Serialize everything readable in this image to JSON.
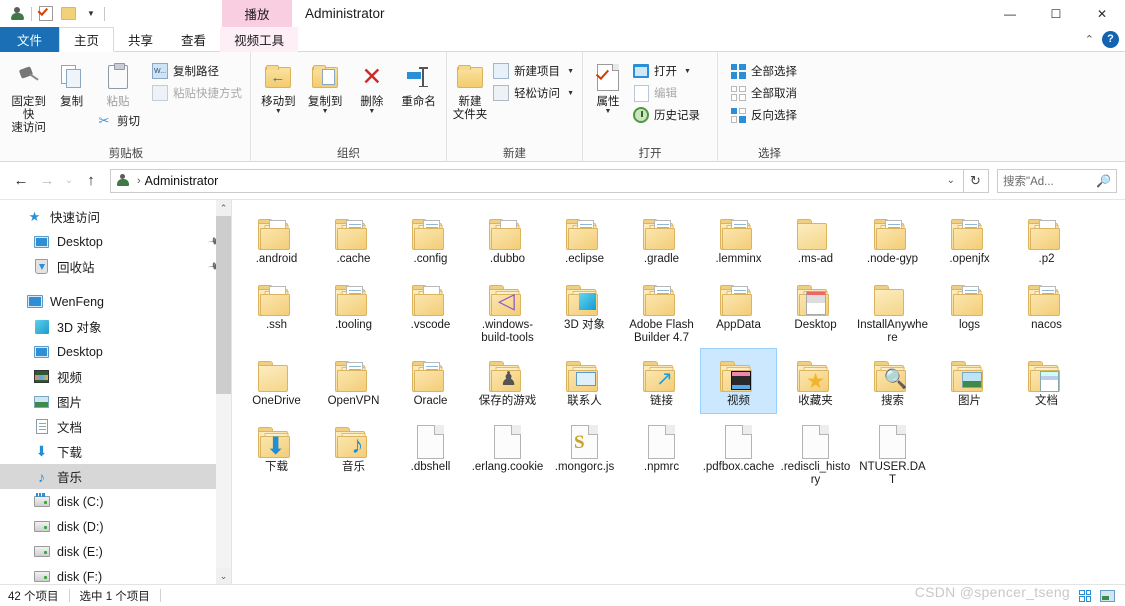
{
  "titlebar": {
    "quick_access": [
      {
        "name": "user-icon",
        "label": ""
      },
      {
        "name": "properties-icon",
        "label": ""
      },
      {
        "name": "new-folder-icon",
        "label": ""
      },
      {
        "name": "customize-dropdown-icon",
        "label": "▾"
      }
    ],
    "context_tab": "播放",
    "title": "Administrator",
    "minimize": "—",
    "maximize": "☐",
    "close": "✕"
  },
  "tabs": {
    "file": "文件",
    "items": [
      {
        "label": "主页",
        "active": true
      },
      {
        "label": "共享",
        "active": false
      },
      {
        "label": "查看",
        "active": false
      }
    ],
    "context_tab": "视频工具",
    "collapse": "⌃",
    "help": "?"
  },
  "ribbon": {
    "groups": [
      {
        "label": "剪贴板",
        "big": [
          {
            "label": "固定到快\n速访问",
            "label1": "固定到快",
            "label2": "速访问",
            "icon": "pin-icon",
            "dim": false
          },
          {
            "label": "复制",
            "label1": "复制",
            "label2": "",
            "icon": "copy-icon",
            "dim": false
          },
          {
            "label": "粘贴",
            "label1": "粘贴",
            "label2": "",
            "icon": "paste-icon",
            "dim": true
          }
        ],
        "small_under_paste": [
          {
            "label": "剪切",
            "icon": "scissors-icon",
            "dim": false
          }
        ],
        "small": [
          {
            "label": "复制路径",
            "icon": "copy-path-icon",
            "dim": false
          },
          {
            "label": "粘贴快捷方式",
            "icon": "paste-shortcut-icon",
            "dim": true
          }
        ]
      },
      {
        "label": "组织",
        "big": [
          {
            "label1": "移动到",
            "label2": "",
            "icon": "move-to-icon",
            "caret": true
          },
          {
            "label1": "复制到",
            "label2": "",
            "icon": "copy-to-icon",
            "caret": true
          },
          {
            "label1": "删除",
            "label2": "",
            "icon": "delete-icon",
            "caret": true
          },
          {
            "label1": "重命名",
            "label2": "",
            "icon": "rename-icon",
            "caret": false
          }
        ]
      },
      {
        "label": "新建",
        "big": [
          {
            "label1": "新建",
            "label2": "文件夹",
            "icon": "new-folder-icon",
            "caret": false
          }
        ],
        "small": [
          {
            "label": "新建项目",
            "icon": "new-item-icon",
            "caret": true
          },
          {
            "label": "轻松访问",
            "icon": "easy-access-icon",
            "caret": true
          }
        ]
      },
      {
        "label": "打开",
        "big": [
          {
            "label1": "属性",
            "label2": "",
            "icon": "properties-icon",
            "caret": true
          }
        ],
        "small": [
          {
            "label": "打开",
            "icon": "open-icon",
            "caret": true,
            "dim": false
          },
          {
            "label": "编辑",
            "icon": "edit-icon",
            "caret": false,
            "dim": true
          },
          {
            "label": "历史记录",
            "icon": "history-icon",
            "caret": false,
            "dim": false
          }
        ]
      },
      {
        "label": "选择",
        "small": [
          {
            "label": "全部选择",
            "icon": "select-all-icon"
          },
          {
            "label": "全部取消",
            "icon": "select-none-icon"
          },
          {
            "label": "反向选择",
            "icon": "invert-selection-icon"
          }
        ]
      }
    ]
  },
  "addressbar": {
    "back": "←",
    "forward": "→",
    "recent": "⌄",
    "up": "↑",
    "breadcrumb_icon": "user-icon",
    "breadcrumb_sep": "›",
    "path": "Administrator",
    "dropdown": "⌄",
    "refresh": "↻",
    "search_placeholder": "搜索\"Ad...",
    "search_value": ""
  },
  "navpane": {
    "items": [
      {
        "label": "快速访问",
        "icon": "star-icon",
        "level": 1,
        "pinned": false,
        "selected": false
      },
      {
        "label": "Desktop",
        "icon": "monitor-icon",
        "level": 2,
        "pinned": true,
        "selected": false
      },
      {
        "label": "回收站",
        "icon": "recycle-bin-icon",
        "level": 2,
        "pinned": true,
        "selected": false
      },
      {
        "label": "",
        "icon": "spacer",
        "level": 1,
        "pinned": false,
        "selected": false,
        "spacer": true
      },
      {
        "label": "WenFeng",
        "icon": "this-pc-icon",
        "level": 1,
        "pinned": false,
        "selected": false
      },
      {
        "label": "3D 对象",
        "icon": "3d-objects-icon",
        "level": 2,
        "pinned": false,
        "selected": false
      },
      {
        "label": "Desktop",
        "icon": "desktop-icon",
        "level": 2,
        "pinned": false,
        "selected": false
      },
      {
        "label": "视频",
        "icon": "videos-icon",
        "level": 2,
        "pinned": false,
        "selected": false
      },
      {
        "label": "图片",
        "icon": "pictures-icon",
        "level": 2,
        "pinned": false,
        "selected": false
      },
      {
        "label": "文档",
        "icon": "documents-icon",
        "level": 2,
        "pinned": false,
        "selected": false
      },
      {
        "label": "下载",
        "icon": "downloads-icon",
        "level": 2,
        "pinned": false,
        "selected": false
      },
      {
        "label": "音乐",
        "icon": "music-icon",
        "level": 2,
        "pinned": false,
        "selected": true
      },
      {
        "label": "disk (C:)",
        "icon": "system-drive-icon",
        "level": 2,
        "pinned": false,
        "selected": false
      },
      {
        "label": "disk (D:)",
        "icon": "drive-icon",
        "level": 2,
        "pinned": false,
        "selected": false
      },
      {
        "label": "disk (E:)",
        "icon": "drive-icon",
        "level": 2,
        "pinned": false,
        "selected": false
      },
      {
        "label": "disk (F:)",
        "icon": "drive-icon",
        "level": 2,
        "pinned": false,
        "selected": false
      }
    ],
    "scroll_up": "⌃",
    "scroll_down": "⌄"
  },
  "files": [
    {
      "name": ".android",
      "type": "folder",
      "variant": "doc",
      "selected": false
    },
    {
      "name": ".cache",
      "type": "folder",
      "variant": "lines",
      "selected": false
    },
    {
      "name": ".config",
      "type": "folder",
      "variant": "lines",
      "selected": false
    },
    {
      "name": ".dubbo",
      "type": "folder",
      "variant": "doc",
      "selected": false
    },
    {
      "name": ".eclipse",
      "type": "folder",
      "variant": "lines",
      "selected": false
    },
    {
      "name": ".gradle",
      "type": "folder",
      "variant": "lines",
      "selected": false
    },
    {
      "name": ".lemminx",
      "type": "folder",
      "variant": "lines",
      "selected": false
    },
    {
      "name": ".ms-ad",
      "type": "folder",
      "variant": "empty",
      "selected": false
    },
    {
      "name": ".node-gyp",
      "type": "folder",
      "variant": "lines",
      "selected": false
    },
    {
      "name": ".openjfx",
      "type": "folder",
      "variant": "lines",
      "selected": false
    },
    {
      "name": ".p2",
      "type": "folder",
      "variant": "doc",
      "selected": false
    },
    {
      "name": ".ssh",
      "type": "folder",
      "variant": "doc",
      "selected": false
    },
    {
      "name": ".tooling",
      "type": "folder",
      "variant": "lines",
      "selected": false
    },
    {
      "name": ".vscode",
      "type": "folder",
      "variant": "doc",
      "selected": false
    },
    {
      "name": ".windows-build-tools",
      "type": "folder",
      "variant": "vscode",
      "selected": false
    },
    {
      "name": "3D 对象",
      "type": "folder",
      "variant": "cube",
      "selected": false
    },
    {
      "name": "Adobe Flash Builder 4.7",
      "type": "folder",
      "variant": "lines",
      "selected": false
    },
    {
      "name": "AppData",
      "type": "folder",
      "variant": "lines",
      "selected": false
    },
    {
      "name": "Desktop",
      "type": "folder",
      "variant": "desktop",
      "selected": false
    },
    {
      "name": "InstallAnywhere",
      "type": "folder",
      "variant": "empty",
      "selected": false
    },
    {
      "name": "logs",
      "type": "folder",
      "variant": "lines",
      "selected": false
    },
    {
      "name": "nacos",
      "type": "folder",
      "variant": "lines",
      "selected": false
    },
    {
      "name": "OneDrive",
      "type": "folder",
      "variant": "empty",
      "selected": false
    },
    {
      "name": "OpenVPN",
      "type": "folder",
      "variant": "lines",
      "selected": false
    },
    {
      "name": "Oracle",
      "type": "folder",
      "variant": "lines",
      "selected": false
    },
    {
      "name": "保存的游戏",
      "type": "folder",
      "variant": "games",
      "selected": false
    },
    {
      "name": "联系人",
      "type": "folder",
      "variant": "contacts",
      "selected": false
    },
    {
      "name": "链接",
      "type": "folder",
      "variant": "links",
      "selected": false
    },
    {
      "name": "视频",
      "type": "folder",
      "variant": "videos",
      "selected": true
    },
    {
      "name": "收藏夹",
      "type": "folder",
      "variant": "favorites",
      "selected": false
    },
    {
      "name": "搜索",
      "type": "folder",
      "variant": "search",
      "selected": false
    },
    {
      "name": "图片",
      "type": "folder",
      "variant": "pictures",
      "selected": false
    },
    {
      "name": "文档",
      "type": "folder",
      "variant": "documents",
      "selected": false
    },
    {
      "name": "下载",
      "type": "folder",
      "variant": "downloads",
      "selected": false
    },
    {
      "name": "音乐",
      "type": "folder",
      "variant": "music",
      "selected": false
    },
    {
      "name": ".dbshell",
      "type": "file",
      "variant": "blank",
      "selected": false
    },
    {
      "name": ".erlang.cookie",
      "type": "file",
      "variant": "blank",
      "selected": false
    },
    {
      "name": ".mongorc.js",
      "type": "file",
      "variant": "mongo",
      "selected": false
    },
    {
      "name": ".npmrc",
      "type": "file",
      "variant": "blank",
      "selected": false
    },
    {
      "name": ".pdfbox.cache",
      "type": "file",
      "variant": "blank",
      "selected": false
    },
    {
      "name": ".rediscli_history",
      "type": "file",
      "variant": "blank",
      "selected": false
    },
    {
      "name": "NTUSER.DAT",
      "type": "file",
      "variant": "blank",
      "selected": false
    }
  ],
  "statusbar": {
    "count": "42 个项目",
    "selection": "选中 1 个项目"
  },
  "watermark": "CSDN @spencer_tseng",
  "colors": {
    "accent": "#1a6fb5",
    "selection": "#cce8ff",
    "selection_border": "#99d1ff",
    "context_tab": "#f9cee0",
    "folder": "#f3cc6e",
    "nav_selected": "#d7d7d7"
  }
}
